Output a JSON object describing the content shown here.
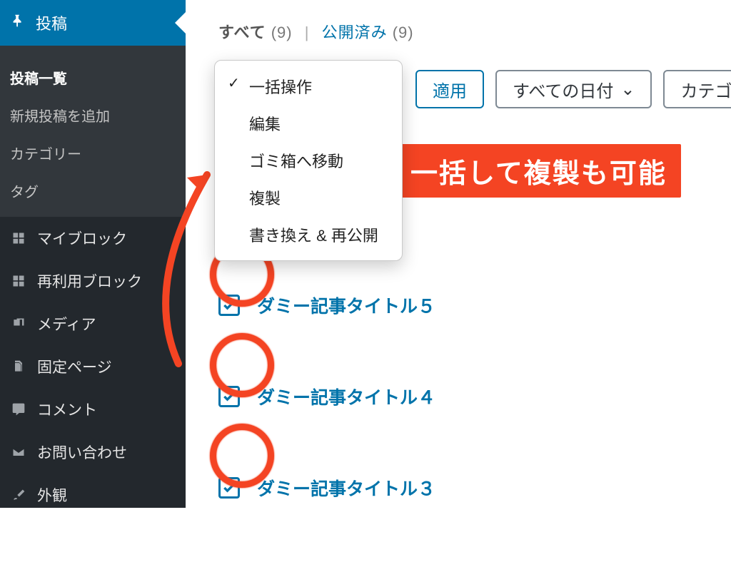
{
  "sidebar": {
    "active": "投稿",
    "sub": [
      {
        "label": "投稿一覧",
        "current": true
      },
      {
        "label": "新規投稿を追加",
        "current": false
      },
      {
        "label": "カテゴリー",
        "current": false
      },
      {
        "label": "タグ",
        "current": false
      }
    ],
    "items": [
      {
        "label": "マイブロック",
        "icon": "grid-icon"
      },
      {
        "label": "再利用ブロック",
        "icon": "grid-icon"
      },
      {
        "label": "メディア",
        "icon": "media-icon"
      },
      {
        "label": "固定ページ",
        "icon": "page-icon"
      },
      {
        "label": "コメント",
        "icon": "comment-icon"
      },
      {
        "label": "お問い合わせ",
        "icon": "mail-icon"
      },
      {
        "label": "外観",
        "icon": "brush-icon"
      }
    ]
  },
  "tabs": {
    "all_label": "すべて",
    "all_count": "(9)",
    "published_label": "公開済み",
    "published_count": "(9)"
  },
  "controls": {
    "apply": "適用",
    "date_filter": "すべての日付",
    "category_filter": "カテゴリー"
  },
  "dropdown": {
    "options": [
      {
        "label": "一括操作",
        "checked": true
      },
      {
        "label": "編集",
        "checked": false
      },
      {
        "label": "ゴミ箱へ移動",
        "checked": false
      },
      {
        "label": "複製",
        "checked": false
      },
      {
        "label": "書き換え & 再公開",
        "checked": false
      }
    ]
  },
  "posts": [
    {
      "title": "ダミー記事タイトル５",
      "checked": true
    },
    {
      "title": "ダミー記事タイトル４",
      "checked": true
    },
    {
      "title": "ダミー記事タイトル３",
      "checked": true
    }
  ],
  "annotation": {
    "callout": "一括して複製も可能"
  },
  "colors": {
    "accent": "#0073aa",
    "annotate": "#f44423"
  }
}
